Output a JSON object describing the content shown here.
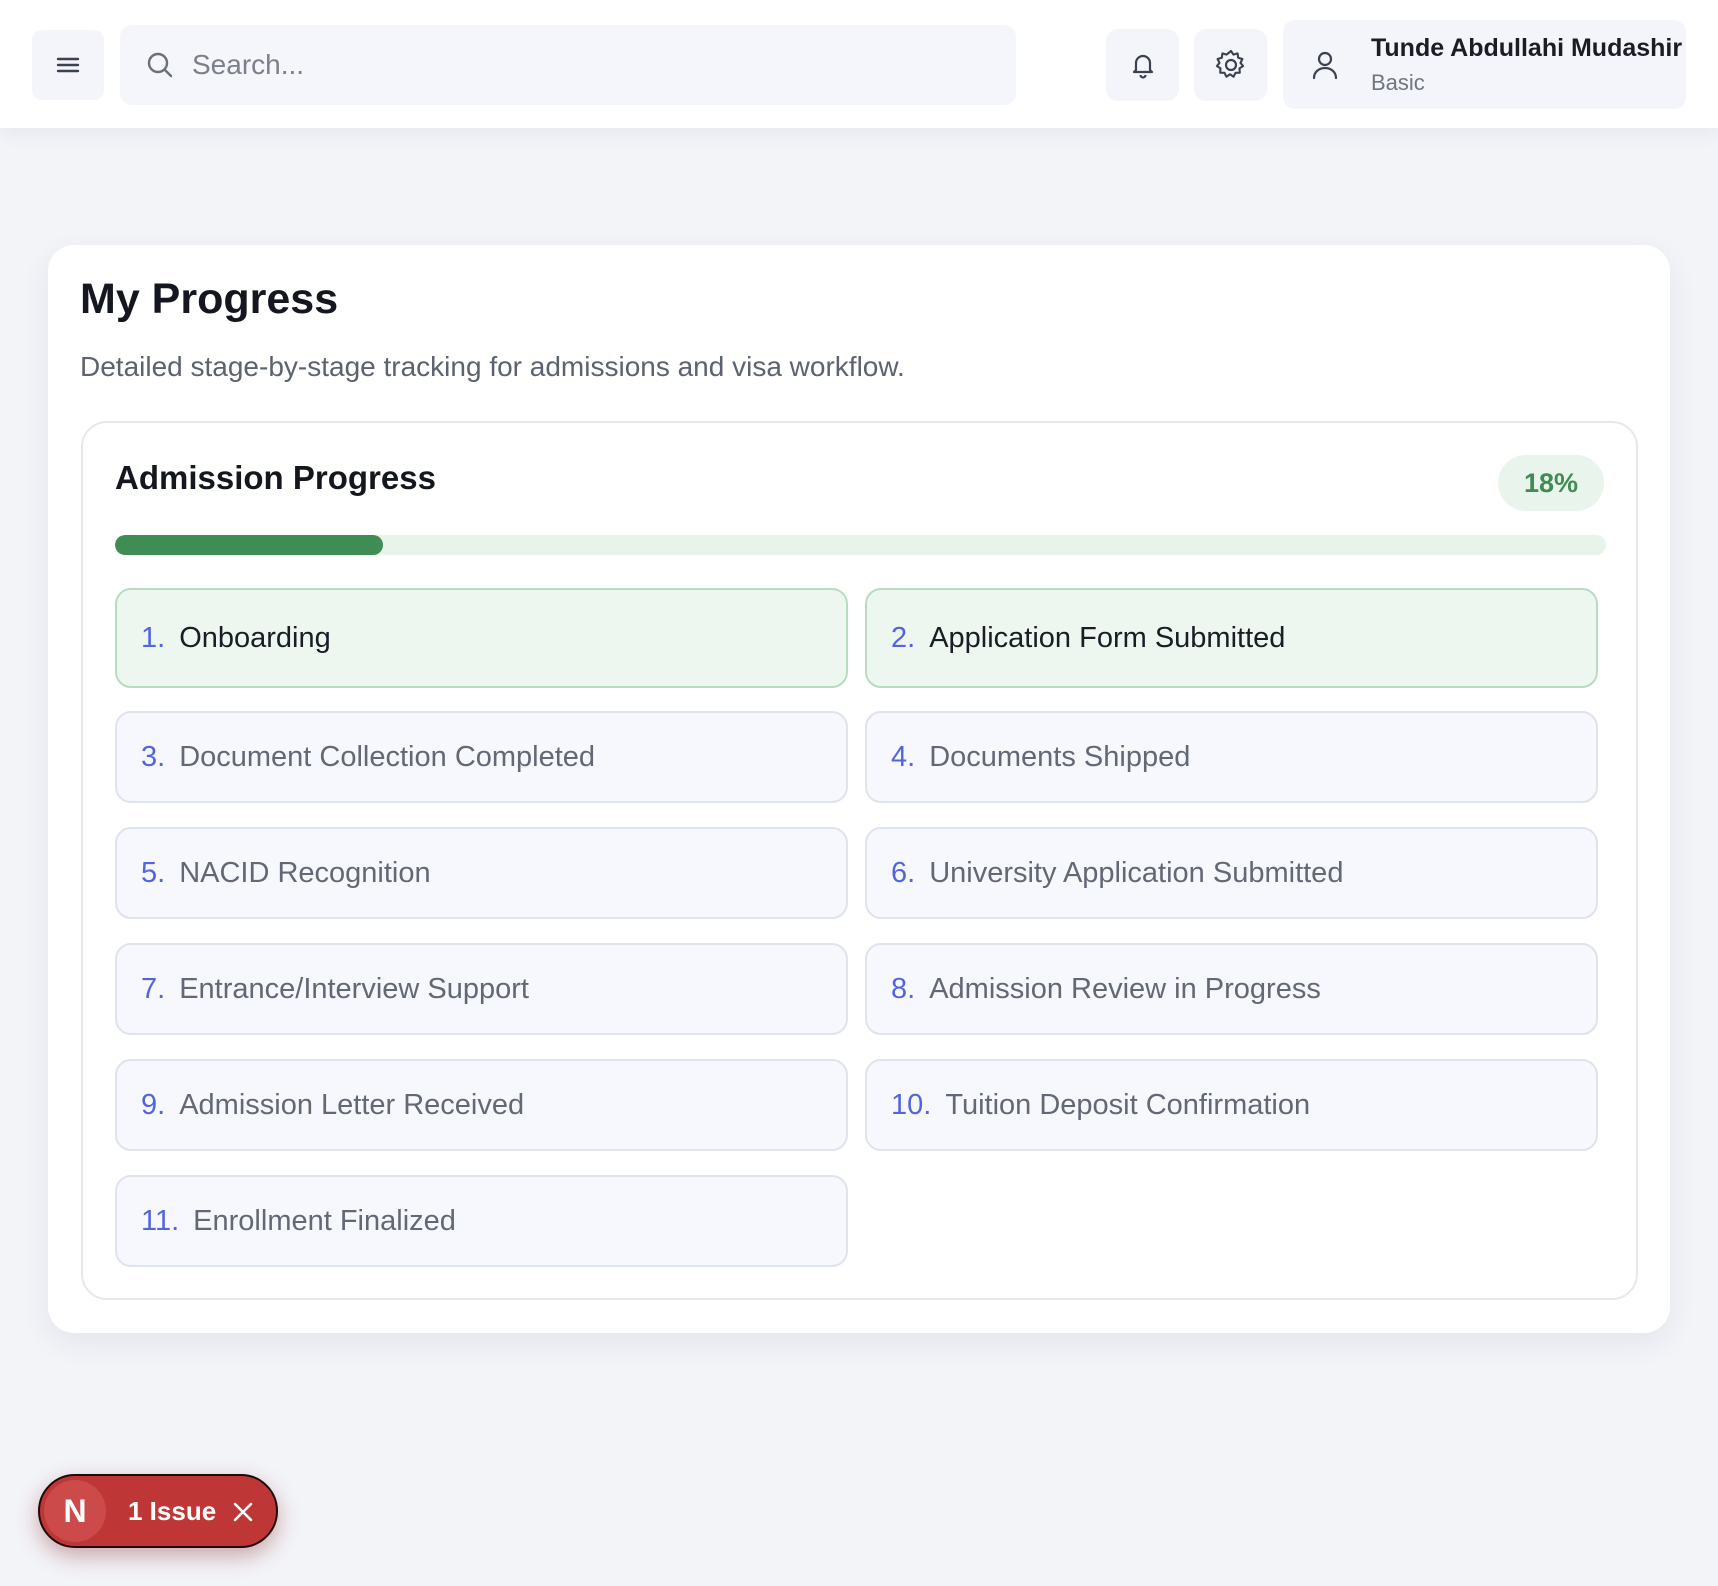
{
  "header": {
    "search_placeholder": "Search...",
    "user": {
      "name": "Tunde Abdullahi Mudashir",
      "plan": "Basic"
    },
    "icons": [
      "menu-icon",
      "search-icon",
      "bell-icon",
      "gear-icon",
      "user-icon"
    ]
  },
  "page": {
    "title": "My Progress",
    "subtitle": "Detailed stage-by-stage tracking for admissions and visa workflow."
  },
  "admission": {
    "title": "Admission Progress",
    "percent_label": "18%",
    "progress_fraction": 0.18,
    "stages": [
      {
        "num": "1.",
        "label": "Onboarding",
        "done": true
      },
      {
        "num": "2.",
        "label": "Application Form Submitted",
        "done": true
      },
      {
        "num": "3.",
        "label": "Document Collection Completed",
        "done": false
      },
      {
        "num": "4.",
        "label": "Documents Shipped",
        "done": false
      },
      {
        "num": "5.",
        "label": "NACID Recognition",
        "done": false
      },
      {
        "num": "6.",
        "label": "University Application Submitted",
        "done": false
      },
      {
        "num": "7.",
        "label": "Entrance/Interview Support",
        "done": false
      },
      {
        "num": "8.",
        "label": "Admission Review in Progress",
        "done": false
      },
      {
        "num": "9.",
        "label": "Admission Letter Received",
        "done": false
      },
      {
        "num": "10.",
        "label": "Tuition Deposit Confirmation",
        "done": false
      },
      {
        "num": "11.",
        "label": "Enrollment Finalized",
        "done": false
      }
    ]
  },
  "issues": {
    "logo_letter": "N",
    "label": "1 Issue"
  },
  "colors": {
    "accent_green": "#3f8c54",
    "stage_number_blue": "#5265de",
    "issue_red": "#bf3636"
  }
}
